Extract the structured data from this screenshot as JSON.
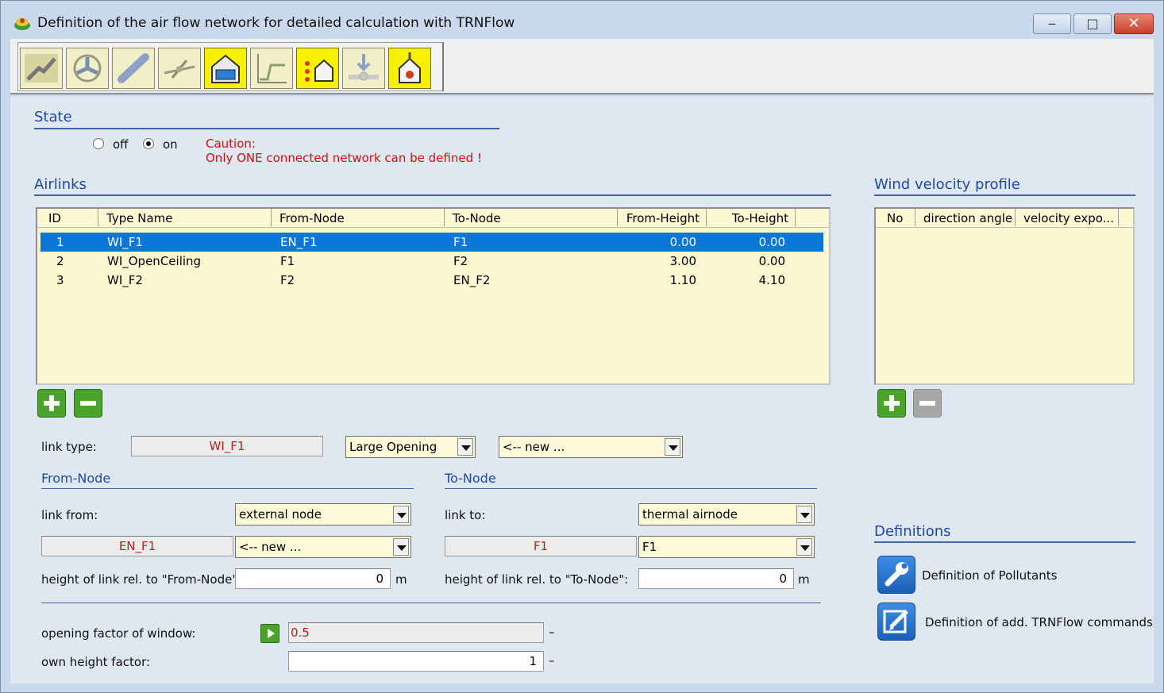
{
  "window": {
    "title": "Definition of the air flow network for detailed calculation with TRNFlow",
    "controls": {
      "minimize": "‒",
      "maximize": "□",
      "close": "✕"
    }
  },
  "toolbar": {
    "buttons": [
      {
        "icon": "airlink-crack-icon",
        "active": false
      },
      {
        "icon": "fan-icon",
        "active": false
      },
      {
        "icon": "duct-icon",
        "active": false
      },
      {
        "icon": "valve-icon",
        "active": false
      },
      {
        "icon": "building-window-icon",
        "active": true
      },
      {
        "icon": "curve-chart-icon",
        "active": false
      },
      {
        "icon": "pollutant-source-icon",
        "active": true
      },
      {
        "icon": "download-node-icon",
        "active": false
      },
      {
        "icon": "upload-node-icon",
        "active": true
      }
    ]
  },
  "state": {
    "title": "State",
    "off_label": "off",
    "on_label": "on",
    "selected": "on",
    "caution_line1": "Caution:",
    "caution_line2": "Only ONE connected network can be defined !"
  },
  "airlinks": {
    "title": "Airlinks",
    "columns": [
      "ID",
      "Type Name",
      "From-Node",
      "To-Node",
      "From-Height",
      "To-Height"
    ],
    "rows": [
      {
        "id": "1",
        "type": "WI_F1",
        "from": "EN_F1",
        "to": "F1",
        "from_h": "0.00",
        "to_h": "0.00",
        "selected": true
      },
      {
        "id": "2",
        "type": "WI_OpenCeiling",
        "from": "F1",
        "to": "F2",
        "from_h": "3.00",
        "to_h": "0.00",
        "selected": false
      },
      {
        "id": "3",
        "type": "WI_F2",
        "from": "F2",
        "to": "EN_F2",
        "from_h": "1.10",
        "to_h": "4.10",
        "selected": false
      }
    ]
  },
  "wind": {
    "title": "Wind velocity profile",
    "columns": [
      "No",
      "direction angle",
      "velocity expo..."
    ]
  },
  "link": {
    "type_label": "link type:",
    "type_value": "WI_F1",
    "type_combo": "Large Opening",
    "new_combo": "<-- new ..."
  },
  "from_node": {
    "title": "From-Node",
    "link_from_label": "link from:",
    "link_from_value": "external node",
    "node_name": "EN_F1",
    "node_combo": "<-- new ...",
    "height_label": "height of link rel. to \"From-Node\"",
    "height_value": "0",
    "unit": "m"
  },
  "to_node": {
    "title": "To-Node",
    "link_to_label": "link to:",
    "link_to_value": "thermal airnode",
    "node_name": "F1",
    "node_combo": "F1",
    "height_label": "height of link rel. to \"To-Node\":",
    "height_value": "0",
    "unit": "m"
  },
  "factors": {
    "opening_label": "opening factor of window:",
    "opening_value": "0.5",
    "opening_unit": "–",
    "own_height_label": "own height factor:",
    "own_height_value": "1",
    "own_height_unit": "–"
  },
  "definitions": {
    "title": "Definitions",
    "pollutants": "Definition of Pollutants",
    "trnflow": "Definition of add. TRNFlow commands"
  },
  "colors": {
    "section_title": "#1d4aa5",
    "selection": "#0a76d7",
    "caution": "#d21010",
    "table_bg": "#fbf8d2"
  }
}
